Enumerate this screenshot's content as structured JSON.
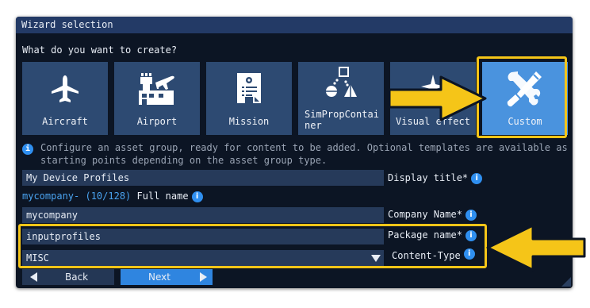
{
  "window": {
    "title": "Wizard selection"
  },
  "question": "What do you want to create?",
  "tiles": [
    {
      "label": "Aircraft",
      "icon": "airplane-icon"
    },
    {
      "label": "Airport",
      "icon": "airport-tower-icon"
    },
    {
      "label": "Mission",
      "icon": "mission-document-icon"
    },
    {
      "label": "SimPropContainer",
      "icon": "sim-prop-container-icon"
    },
    {
      "label": "Visual effect",
      "icon": "sparkle-icon"
    },
    {
      "label": "Custom",
      "icon": "custom-tools-icon"
    }
  ],
  "selected_tile": "Custom",
  "description": "Configure an asset group, ready for content to be added. Optional templates are available as starting points depending on the asset group type.",
  "fields": {
    "display_title": {
      "value": "My Device Profiles",
      "label": "Display title*"
    },
    "full_name": {
      "prefix": "mycompany-",
      "count": "(10/128)",
      "label": "Full name"
    },
    "company_name": {
      "value": "mycompany",
      "label": "Company Name*"
    },
    "package_name": {
      "value": "inputprofiles",
      "label": "Package name*"
    },
    "content_type": {
      "value": "MISC",
      "label": "Content-Type"
    }
  },
  "info_glyph": "i",
  "buttons": {
    "back": "Back",
    "next": "Next"
  },
  "colors": {
    "highlight": "#f5c518",
    "title_bar": "#233a66",
    "tile": "#2d4a72",
    "tile_selected": "#4a93de",
    "info": "#2f8ff0",
    "next_button": "#2f85e0"
  }
}
